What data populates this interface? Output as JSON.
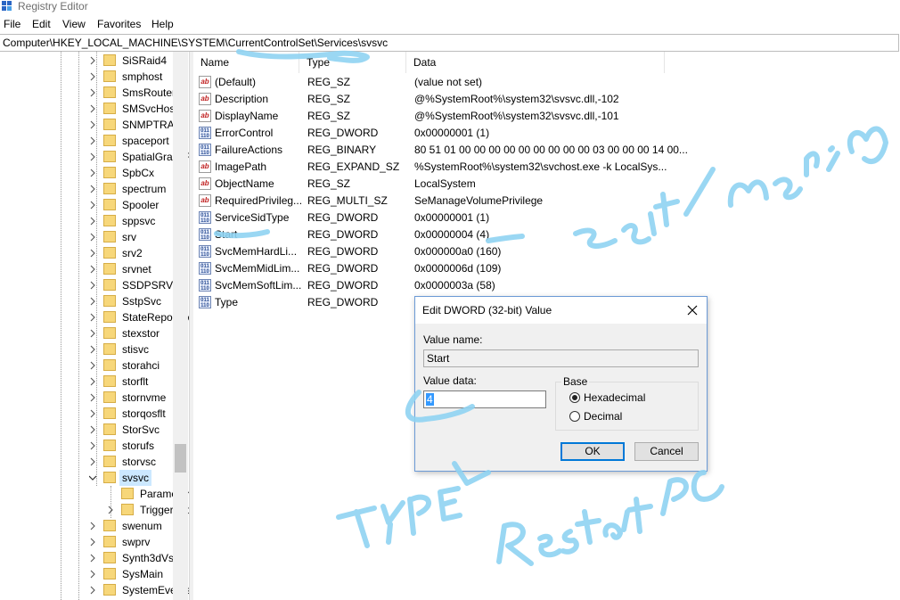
{
  "window": {
    "title": "Registry Editor"
  },
  "menu": {
    "items": [
      "File",
      "Edit",
      "View",
      "Favorites",
      "Help"
    ]
  },
  "address": {
    "path": "Computer\\HKEY_LOCAL_MACHINE\\SYSTEM\\CurrentControlSet\\Services\\svsvc"
  },
  "tree": {
    "items": [
      "SiSRaid4",
      "smphost",
      "SmsRouter",
      "SMSvcHost",
      "SNMPTRAP",
      "spaceport",
      "SpatialGraphFilter",
      "SpbCx",
      "spectrum",
      "Spooler",
      "sppsvc",
      "srv",
      "srv2",
      "srvnet",
      "SSDPSRV",
      "SstpSvc",
      "StateRepository",
      "stexstor",
      "stisvc",
      "storahci",
      "storflt",
      "stornvme",
      "storqosflt",
      "StorSvc",
      "storufs",
      "storvsc",
      "svsvc",
      "Parameters",
      "TriggerInfo",
      "swenum",
      "swprv",
      "Synth3dVsc",
      "SysMain",
      "SystemEventsBroker"
    ]
  },
  "list": {
    "headers": {
      "name": "Name",
      "type": "Type",
      "data": "Data"
    },
    "rows": [
      {
        "name": "(Default)",
        "type": "REG_SZ",
        "data": "(value not set)",
        "icon": "string-value-icon"
      },
      {
        "name": "Description",
        "type": "REG_SZ",
        "data": "@%SystemRoot%\\system32\\svsvc.dll,-102",
        "icon": "string-value-icon"
      },
      {
        "name": "DisplayName",
        "type": "REG_SZ",
        "data": "@%SystemRoot%\\system32\\svsvc.dll,-101",
        "icon": "string-value-icon"
      },
      {
        "name": "ErrorControl",
        "type": "REG_DWORD",
        "data": "0x00000001 (1)",
        "icon": "binary-value-icon"
      },
      {
        "name": "FailureActions",
        "type": "REG_BINARY",
        "data": "80 51 01 00 00 00 00 00 00 00 00 00 03 00 00 00 14 00...",
        "icon": "binary-value-icon"
      },
      {
        "name": "ImagePath",
        "type": "REG_EXPAND_SZ",
        "data": "%SystemRoot%\\system32\\svchost.exe -k LocalSys...",
        "icon": "string-value-icon"
      },
      {
        "name": "ObjectName",
        "type": "REG_SZ",
        "data": "LocalSystem",
        "icon": "string-value-icon"
      },
      {
        "name": "RequiredPrivileg...",
        "type": "REG_MULTI_SZ",
        "data": "SeManageVolumePrivilege",
        "icon": "string-value-icon"
      },
      {
        "name": "ServiceSidType",
        "type": "REG_DWORD",
        "data": "0x00000001 (1)",
        "icon": "binary-value-icon"
      },
      {
        "name": "Start",
        "type": "REG_DWORD",
        "data": "0x00000004 (4)",
        "icon": "binary-value-icon"
      },
      {
        "name": "SvcMemHardLi...",
        "type": "REG_DWORD",
        "data": "0x000000a0 (160)",
        "icon": "binary-value-icon"
      },
      {
        "name": "SvcMemMidLim...",
        "type": "REG_DWORD",
        "data": "0x0000006d (109)",
        "icon": "binary-value-icon"
      },
      {
        "name": "SvcMemSoftLim...",
        "type": "REG_DWORD",
        "data": "0x0000003a (58)",
        "icon": "binary-value-icon"
      },
      {
        "name": "Type",
        "type": "REG_DWORD",
        "data": "",
        "icon": "binary-value-icon"
      }
    ]
  },
  "dialog": {
    "title": "Edit DWORD (32-bit) Value",
    "value_name_label": "Value name:",
    "value_name": "Start",
    "value_data_label": "Value data:",
    "value_data": "4",
    "base_label": "Base",
    "hex_label": "Hexadecimal",
    "dec_label": "Decimal",
    "ok_label": "OK",
    "cancel_label": "Cancel"
  },
  "colors": {
    "annotation": "#6fc3ea",
    "selection": "#cce8ff",
    "accent": "#0078d7"
  }
}
